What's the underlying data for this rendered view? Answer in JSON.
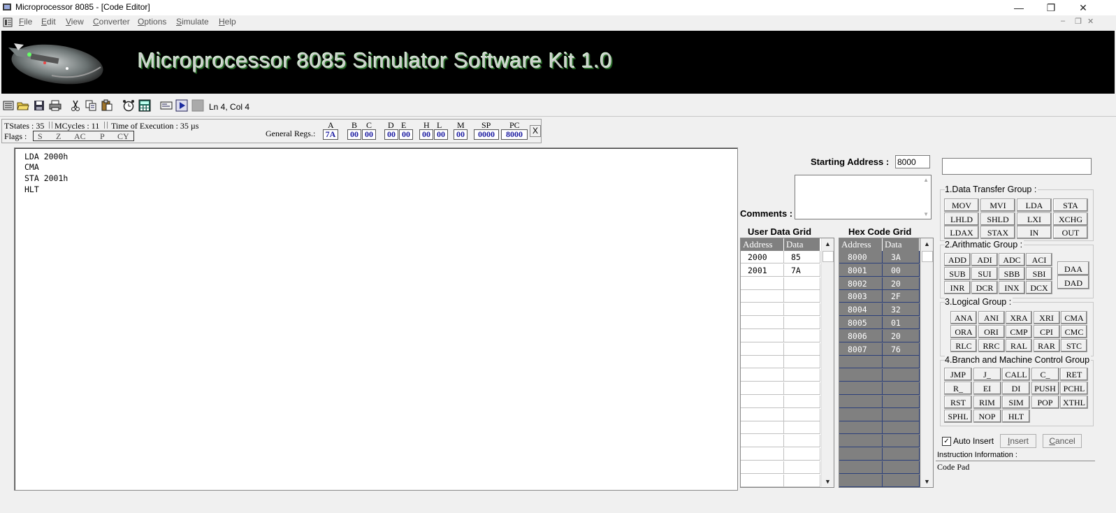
{
  "window": {
    "title": "Microprocessor 8085 - [Code Editor]"
  },
  "menu": [
    "File",
    "Edit",
    "View",
    "Converter",
    "Options",
    "Simulate",
    "Help"
  ],
  "banner": {
    "title": "Microprocessor 8085 Simulator Software Kit 1.0"
  },
  "statusbar": {
    "cursor": "Ln 4, Col 4"
  },
  "exec": {
    "tstates": "TStates : 35",
    "mcycles": "MCycles : 11",
    "time": "Time of Execution : 35 µs",
    "flags_label": "Flags :",
    "flags": [
      "S",
      "Z",
      "AC",
      "P",
      "CY"
    ],
    "general_regs_label": "General Regs.:",
    "regs": [
      {
        "name": "A",
        "value": "7A"
      },
      {
        "name": "B",
        "value": "00"
      },
      {
        "name": "C",
        "value": "00"
      },
      {
        "name": "D",
        "value": "00"
      },
      {
        "name": "E",
        "value": "00"
      },
      {
        "name": "H",
        "value": "00"
      },
      {
        "name": "L",
        "value": "00"
      },
      {
        "name": "M",
        "value": "00"
      },
      {
        "name": "SP",
        "value": "0000"
      },
      {
        "name": "PC",
        "value": "8000"
      }
    ],
    "close": "X"
  },
  "editor": {
    "lines": [
      "LDA 2000h",
      "CMA",
      "STA 2001h",
      "HLT"
    ]
  },
  "right": {
    "starting_address_label": "Starting Address :",
    "starting_address": "8000",
    "comments_label": "Comments :",
    "user_grid_title": "User Data Grid",
    "hex_grid_title": "Hex Code Grid",
    "col_address": "Address",
    "col_data": "Data",
    "user_rows": [
      [
        "2000",
        "85"
      ],
      [
        "2001",
        "7A"
      ]
    ],
    "hex_rows": [
      [
        "8000",
        "3A"
      ],
      [
        "8001",
        "00"
      ],
      [
        "8002",
        "20"
      ],
      [
        "8003",
        "2F"
      ],
      [
        "8004",
        "32"
      ],
      [
        "8005",
        "01"
      ],
      [
        "8006",
        "20"
      ],
      [
        "8007",
        "76"
      ]
    ]
  },
  "groups": {
    "g1": {
      "title": "1.Data Transfer Group :",
      "buttons": [
        "MOV",
        "MVI",
        "LDA",
        "STA",
        "LHLD",
        "SHLD",
        "LXI",
        "XCHG",
        "LDAX",
        "STAX",
        "IN",
        "OUT"
      ]
    },
    "g2": {
      "title": "2.Arithmatic Group :",
      "buttons": [
        "ADD",
        "ADI",
        "ADC",
        "ACI",
        "SUB",
        "SUI",
        "SBB",
        "SBI",
        "INR",
        "DCR",
        "INX",
        "DCX"
      ],
      "side": [
        "DAA",
        "DAD"
      ]
    },
    "g3": {
      "title": "3.Logical Group :",
      "buttons": [
        "ANA",
        "ANI",
        "XRA",
        "XRI",
        "CMA",
        "ORA",
        "ORI",
        "CMP",
        "CPI",
        "CMC",
        "RLC",
        "RRC",
        "RAL",
        "RAR",
        "STC"
      ]
    },
    "g4": {
      "title": "4.Branch and Machine Control Group",
      "buttons": [
        "JMP",
        "J_",
        "CALL",
        "C_",
        "RET",
        "R_",
        "EI",
        "DI",
        "PUSH",
        "PCHL",
        "RST",
        "RIM",
        "SIM",
        "POP",
        "XTHL",
        "SPHL",
        "NOP",
        "HLT"
      ]
    }
  },
  "bottom": {
    "auto_insert": "Auto Insert",
    "auto_insert_checked": "✓",
    "insert": "Insert",
    "cancel": "Cancel",
    "info_label": "Instruction Information :",
    "info_text": "Code Pad"
  }
}
